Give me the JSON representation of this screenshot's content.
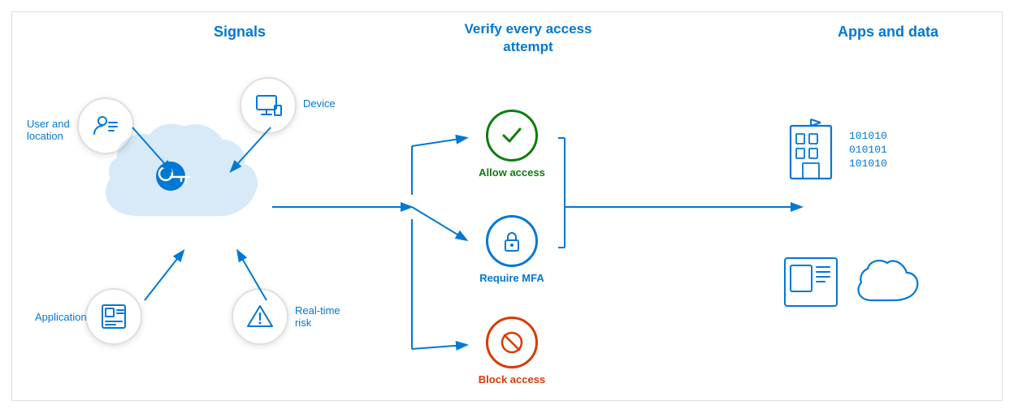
{
  "diagram": {
    "signals": {
      "title": "Signals",
      "items": [
        {
          "id": "user-location",
          "label": "User and\nlocation"
        },
        {
          "id": "device",
          "label": "Device"
        },
        {
          "id": "application",
          "label": "Application"
        },
        {
          "id": "realtime-risk",
          "label": "Real-time\nrisk"
        }
      ]
    },
    "verify": {
      "title": "Verify every access\nattempt",
      "outcomes": [
        {
          "id": "allow",
          "label": "Allow access",
          "color": "#107c10"
        },
        {
          "id": "mfa",
          "label": "Require MFA",
          "color": "#0078d4"
        },
        {
          "id": "block",
          "label": "Block access",
          "color": "#d83b01"
        }
      ]
    },
    "apps": {
      "title": "Apps and data",
      "items": [
        {
          "id": "building",
          "label": ""
        },
        {
          "id": "data-binary",
          "label": ""
        },
        {
          "id": "portal",
          "label": ""
        },
        {
          "id": "cloud",
          "label": ""
        }
      ]
    }
  },
  "colors": {
    "blue": "#0078d4",
    "green": "#107c10",
    "orange": "#d83b01",
    "lightblue": "#deecf9"
  }
}
